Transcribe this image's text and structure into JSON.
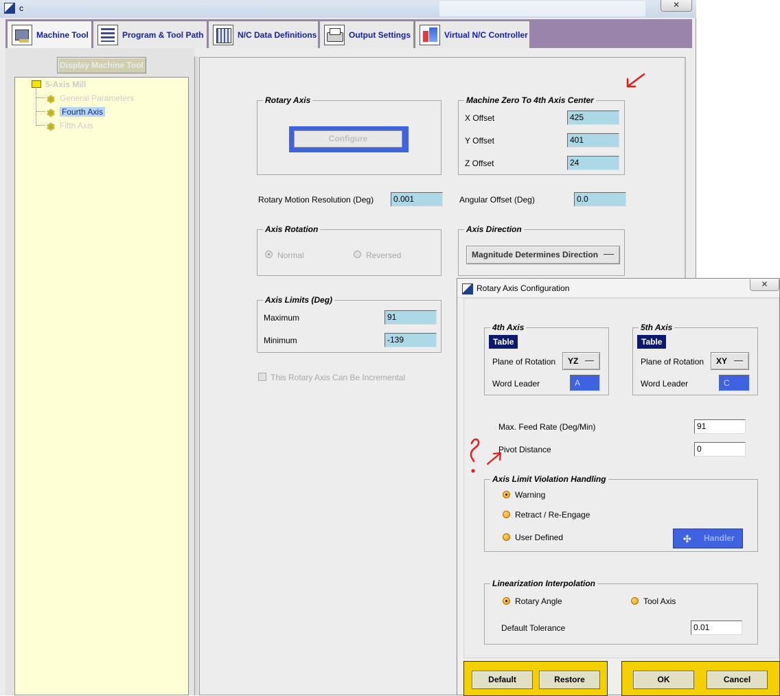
{
  "window": {
    "title": "c"
  },
  "tabs": [
    {
      "label": "Machine Tool",
      "icon": "machine-tool-icon"
    },
    {
      "label": "Program & Tool Path",
      "icon": "program-tool-path-icon"
    },
    {
      "label": "N/C Data Definitions",
      "icon": "nc-data-icon"
    },
    {
      "label": "Output Settings",
      "icon": "printer-icon"
    },
    {
      "label": "Virtual N/C Controller",
      "icon": "virtual-controller-icon"
    }
  ],
  "left_panel": {
    "display_button": "Display Machine Tool",
    "tree": {
      "root": "5-Axis Mill",
      "items": [
        "General Parameters",
        "Fourth Axis",
        "Fifth Axis"
      ],
      "selected": "Fourth Axis"
    }
  },
  "rotary_axis": {
    "legend": "Rotary Axis",
    "configure_label": "Configure"
  },
  "machine_zero": {
    "legend": "Machine Zero To 4th Axis Center",
    "x_label": "X Offset",
    "x_value": "425",
    "y_label": "Y Offset",
    "y_value": "401",
    "z_label": "Z Offset",
    "z_value": "24"
  },
  "resolution": {
    "label": "Rotary Motion Resolution (Deg)",
    "value": "0.001"
  },
  "angular_offset": {
    "label": "Angular Offset  (Deg)",
    "value": "0.0"
  },
  "axis_rotation": {
    "legend": "Axis Rotation",
    "normal": "Normal",
    "reversed": "Reversed"
  },
  "axis_direction": {
    "legend": "Axis Direction",
    "value": "Magnitude Determines Direction"
  },
  "axis_limits": {
    "legend": "Axis Limits (Deg)",
    "max_label": "Maximum",
    "max_value": "91",
    "min_label": "Minimum",
    "min_value": "-139"
  },
  "incremental": {
    "label": "This Rotary Axis Can Be Incremental"
  },
  "dialog": {
    "title": "Rotary Axis Configuration",
    "fourth_axis": {
      "legend": "4th Axis",
      "type": "Table",
      "plane_label": "Plane of Rotation",
      "plane_value": "YZ",
      "word_label": "Word Leader",
      "word_value": "A"
    },
    "fifth_axis": {
      "legend": "5th Axis",
      "type": "Table",
      "plane_label": "Plane of Rotation",
      "plane_value": "XY",
      "word_label": "Word Leader",
      "word_value": "C"
    },
    "max_feed": {
      "label": "Max. Feed Rate (Deg/Min)",
      "value": "91"
    },
    "pivot": {
      "label": "Pivot Distance",
      "value": "0"
    },
    "limit_violation": {
      "legend": "Axis Limit Violation Handling",
      "warning": "Warning",
      "retract": "Retract / Re-Engage",
      "user_defined": "User Defined",
      "handler": "Handler"
    },
    "linearization": {
      "legend": "Linearization Interpolation",
      "rotary_angle": "Rotary Angle",
      "tool_axis": "Tool Axis",
      "tolerance_label": "Default Tolerance",
      "tolerance_value": "0.01"
    },
    "buttons": {
      "default": "Default",
      "restore": "Restore",
      "ok": "OK",
      "cancel": "Cancel"
    }
  },
  "colors": {
    "tab_strip": "#9b84ab",
    "tree_background": "#ffffd6",
    "field_background": "#add8e6",
    "accent_blue": "#3f63e0",
    "badge_navy": "#0c1a6e",
    "button_bar_yellow": "#f5d000",
    "annotation_red": "#e81c1c"
  }
}
